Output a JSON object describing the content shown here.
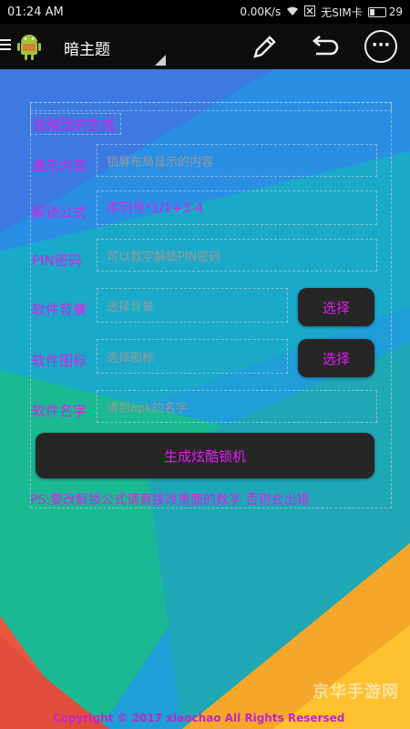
{
  "status_bar": {
    "time": "01:24 AM",
    "speed": "0.00K/s",
    "sim": "无SIM卡",
    "battery": "29"
  },
  "app_bar": {
    "title": "暗主题",
    "menu_icon": "hamburger-menu-icon",
    "app_icon": "android-icon",
    "edit_icon": "pencil-icon",
    "back_icon": "undo-icon",
    "more_icon": "more-icon"
  },
  "form": {
    "header": "炫酷锁的生成",
    "fields": [
      {
        "label": "显示内容",
        "placeholder": "锁屏布局显示的内容",
        "value": ""
      },
      {
        "label": "解锁公式",
        "placeholder": "",
        "value": "序列号*1/1+3-4"
      },
      {
        "label": "PIN密码",
        "placeholder": "可以数字解锁PIN密码",
        "value": ""
      },
      {
        "label": "软件背景",
        "placeholder": "选择背景",
        "value": "",
        "button": "选择"
      },
      {
        "label": "软件图标",
        "placeholder": "选择图标",
        "value": "",
        "button": "选择"
      },
      {
        "label": "软件名字",
        "placeholder": "请到apk的名字",
        "value": ""
      }
    ],
    "generate_button": "生成炫酷锁机",
    "note": "PS:要改解锁公式请直接改里面的数字 否则会出错"
  },
  "footer": {
    "copyright": "Copyright © 2017 xiaochao All Rights Resersed"
  },
  "watermark": {
    "text": "京华手游网"
  },
  "colors": {
    "accent_text": "#d820e8",
    "button_bg": "#262626",
    "bar_bg": "#0d0d0d"
  }
}
